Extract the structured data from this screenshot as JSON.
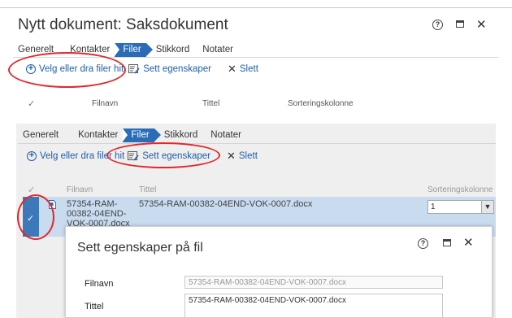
{
  "top_panel": {
    "title": "Nytt dokument: Saksdokument",
    "help_icon": "?",
    "close_icon": "✕",
    "tabs": [
      "Generelt",
      "Kontakter",
      "Filer",
      "Stikkord",
      "Notater"
    ],
    "active_tab": "Filer",
    "toolbar": {
      "add": "Velg eller dra filer hit",
      "props": "Sett egenskaper",
      "delete": "Slett"
    },
    "columns": {
      "check": "✓",
      "filename": "Filnavn",
      "title": "Tittel",
      "sort": "Sorteringskolonne"
    }
  },
  "bottom_panel": {
    "tabs": [
      "Generelt",
      "Kontakter",
      "Filer",
      "Stikkord",
      "Notater"
    ],
    "active_tab": "Filer",
    "toolbar": {
      "add": "Velg eller dra filer hit",
      "props": "Sett egenskaper",
      "delete": "Slett"
    },
    "columns": {
      "check": "✓",
      "filename": "Filnavn",
      "title": "Tittel",
      "sort": "Sorteringskolonne"
    },
    "row": {
      "check": "✓",
      "filename_lines": [
        "57354-RAM-",
        "00382-04END-",
        "VOK-0007.docx"
      ],
      "title": "57354-RAM-00382-04END-VOK-0007.docx",
      "sort_value": "1"
    }
  },
  "dialog": {
    "title": "Sett egenskaper på fil",
    "help_icon": "?",
    "close_icon": "✕",
    "filename_label": "Filnavn",
    "filename_value": "57354-RAM-00382-04END-VOK-0007.docx",
    "title_label": "Tittel",
    "title_value": "57354-RAM-00382-04END-VOK-0007.docx"
  },
  "annotation_color": "#e3272c",
  "accent_color": "#2b6cb6"
}
